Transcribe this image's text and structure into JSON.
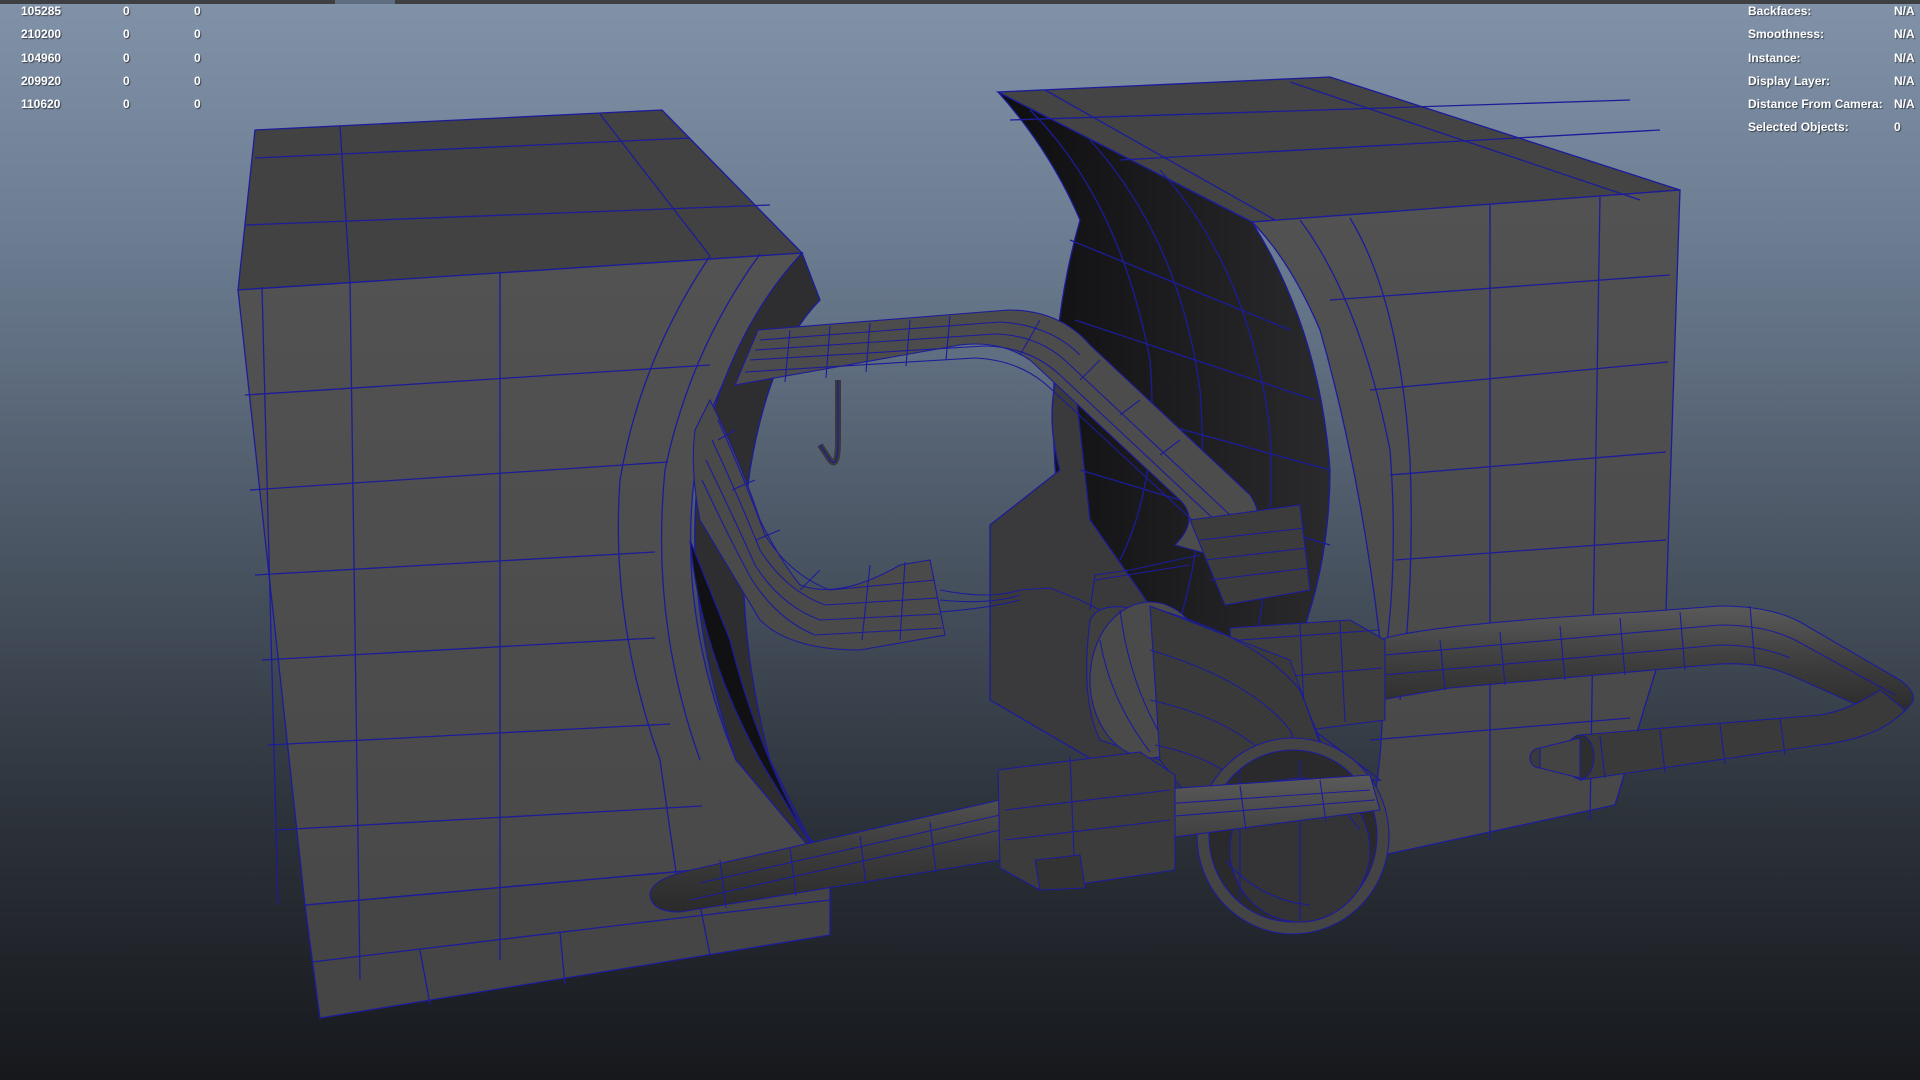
{
  "viewport": {
    "background_top": "#8192a8",
    "background_bottom": "#16181c",
    "wireframe_color": "#1c1c9a",
    "shaded_color": "#4a4a4a"
  },
  "poly_count": {
    "rows": [
      [
        "105285",
        "0",
        "0"
      ],
      [
        "210200",
        "0",
        "0"
      ],
      [
        "104960",
        "0",
        "0"
      ],
      [
        "209920",
        "0",
        "0"
      ],
      [
        "110620",
        "0",
        "0"
      ]
    ]
  },
  "object_info": {
    "rows": [
      {
        "label": "Backfaces:",
        "value": "N/A"
      },
      {
        "label": "Smoothness:",
        "value": "N/A"
      },
      {
        "label": "Instance:",
        "value": "N/A"
      },
      {
        "label": "Display Layer:",
        "value": "N/A"
      },
      {
        "label": "Distance From Camera:",
        "value": "N/A"
      },
      {
        "label": "Selected Objects:",
        "value": "0"
      }
    ]
  }
}
